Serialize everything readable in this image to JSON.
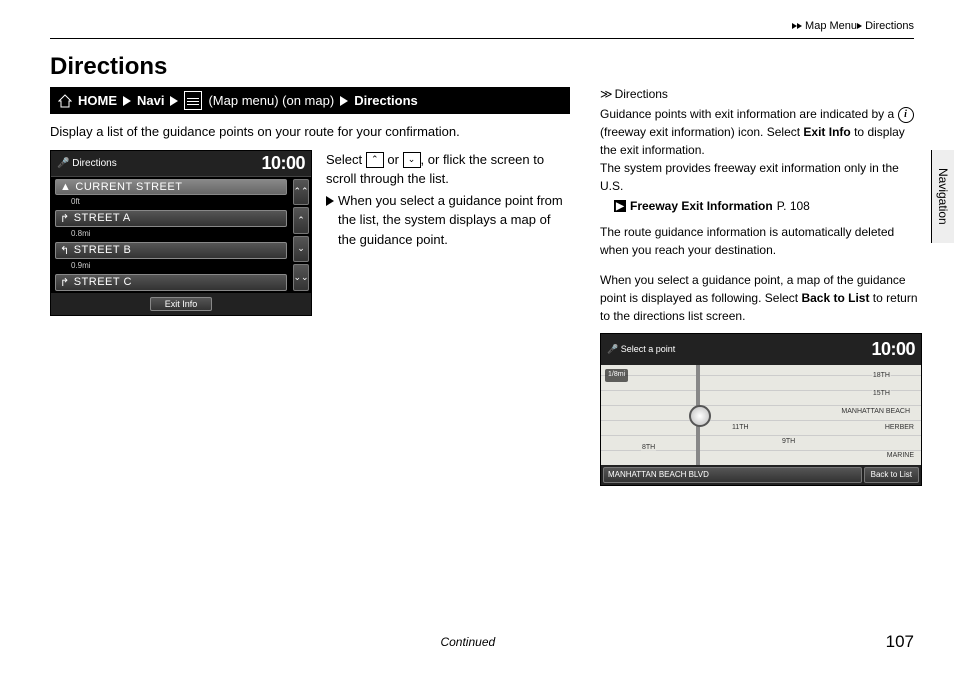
{
  "breadcrumb": {
    "l1": "Map Menu",
    "l2": "Directions"
  },
  "section_title": "Directions",
  "nav_path": {
    "home": "HOME",
    "navi": "Navi",
    "map_menu": "(Map menu) (on map)",
    "directions": "Directions"
  },
  "intro": "Display a list of the guidance points on your route for your confirmation.",
  "screen1": {
    "title": "Directions",
    "time": "10:00",
    "rows": [
      {
        "name": "CURRENT STREET",
        "dist": "0ft"
      },
      {
        "name": "STREET A",
        "dist": "0.8mi"
      },
      {
        "name": "STREET B",
        "dist": "0.9mi"
      },
      {
        "name": "STREET C",
        "dist": ""
      }
    ],
    "exit_info": "Exit Info"
  },
  "instructions": {
    "p1a": "Select ",
    "p1b": " or ",
    "p1c": ", or flick the screen to scroll through the list.",
    "p2": "When you select a guidance point from the list, the system displays a map of the guidance point."
  },
  "side": {
    "header": "Directions",
    "p1a": "Guidance points with exit information are indicated by a ",
    "p1b": " (freeway exit information) icon. Select ",
    "p1c_bold": "Exit Info",
    "p1d": " to display the exit information.",
    "p2": "The system provides freeway exit information only in the U.S.",
    "xref_label": "Freeway Exit Information",
    "xref_page": "P. 108",
    "p3": "The route guidance information is automatically deleted when you reach your destination.",
    "p4a": "When you select a guidance point, a map of the guidance point is displayed as following. Select ",
    "p4b_bold": "Back to List",
    "p4c": " to return to the directions list screen."
  },
  "screen2": {
    "title": "Select a point",
    "time": "10:00",
    "scale": "1/8mi",
    "streets": {
      "a": "18TH",
      "b": "15TH",
      "c": "MANHATTAN BEACH",
      "d": "11TH",
      "e": "9TH",
      "f": "8TH",
      "g": "HERBER",
      "h": "MARINE"
    },
    "addr": "MANHATTAN BEACH BLVD",
    "back": "Back to List"
  },
  "footer": {
    "continued": "Continued",
    "page": "107"
  },
  "side_tab": "Navigation"
}
